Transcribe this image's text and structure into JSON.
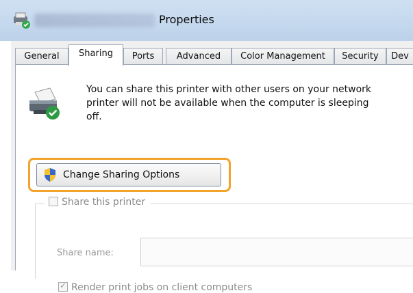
{
  "window": {
    "title_blurred": "imageRUNNER 2206F",
    "title": "Properties"
  },
  "tabs": [
    {
      "label": "General"
    },
    {
      "label": "Sharing"
    },
    {
      "label": "Ports"
    },
    {
      "label": "Advanced"
    },
    {
      "label": "Color Management"
    },
    {
      "label": "Security"
    },
    {
      "label": "Dev"
    }
  ],
  "sharing": {
    "info_lines": [
      "You can share this printer with other users on your network",
      "printer will not be available when the computer is sleeping",
      "off."
    ],
    "change_button_label": "Change Sharing Options",
    "share_checkbox_label": "Share this printer",
    "share_name_label": "Share name:",
    "share_name_value": "",
    "render_checkbox_label": "Render print jobs on client computers"
  },
  "colors": {
    "highlight": "#f2a32c",
    "titlebar": "#cfe0f2"
  },
  "icons": {
    "title": "printer-share-icon",
    "printer": "printer-share-icon",
    "shield": "uac-shield-icon"
  }
}
